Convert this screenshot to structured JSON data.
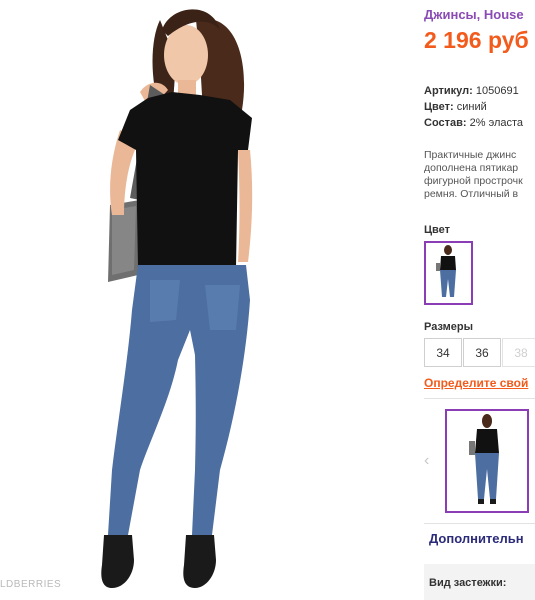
{
  "product": {
    "title": "Джинсы, House",
    "price": "2 196 руб",
    "article_label": "Артикул:",
    "article_value": "1050691",
    "color_label": "Цвет:",
    "color_value": "синий",
    "composition_label": "Состав:",
    "composition_value": "2% эласта",
    "description": [
      "Практичные джинс",
      "дополнена пятикар",
      "фигурной прострочк",
      "ремня. Отличный в"
    ]
  },
  "color_section": {
    "label": "Цвет"
  },
  "sizes": {
    "label": "Размеры",
    "options": [
      {
        "value": "34",
        "available": true
      },
      {
        "value": "36",
        "available": true
      },
      {
        "value": "38",
        "available": false
      }
    ],
    "size_link": "Определите свой"
  },
  "gallery": {
    "prev_arrow": "‹"
  },
  "more": {
    "label": "Дополнительн"
  },
  "clasp": {
    "label": "Вид застежки:"
  },
  "watermark": "LDBERRIES",
  "icons": {
    "gallery_prev": "chevron-left-icon"
  },
  "colors": {
    "title": "#8a4bb5",
    "price": "#f25b1c",
    "selection_border": "#8a3db5",
    "link": "#f25b1c",
    "more_link": "#2b2b7a"
  }
}
